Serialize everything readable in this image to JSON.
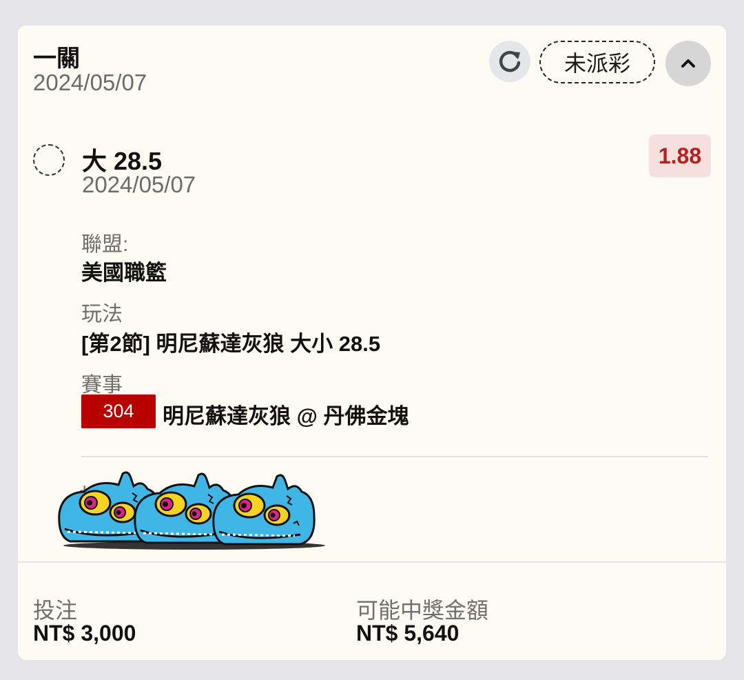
{
  "header": {
    "title": "一關",
    "date": "2024/05/07",
    "status": "未派彩",
    "refresh_icon": "refresh-icon",
    "collapse_icon": "chevron-up-icon"
  },
  "selection": {
    "name": "大 28.5",
    "date": "2024/05/07",
    "odds": "1.88",
    "odds_color": "#b22222",
    "odds_bg": "#f6e0dd"
  },
  "details": {
    "league_label": "聯盟:",
    "league_value": "美國職籃",
    "play_label": "玩法",
    "play_value": "[第2節] 明尼蘇達灰狼 大小 28.5",
    "event_label": "賽事",
    "event_code": "304",
    "event_code_color": "#b80000",
    "event_value": "明尼蘇達灰狼 @ 丹佛金塊"
  },
  "footer": {
    "stake_label": "投注",
    "stake_value": "NT$ 3,000",
    "payout_label": "可能中獎金額",
    "payout_value": "NT$ 5,640"
  }
}
